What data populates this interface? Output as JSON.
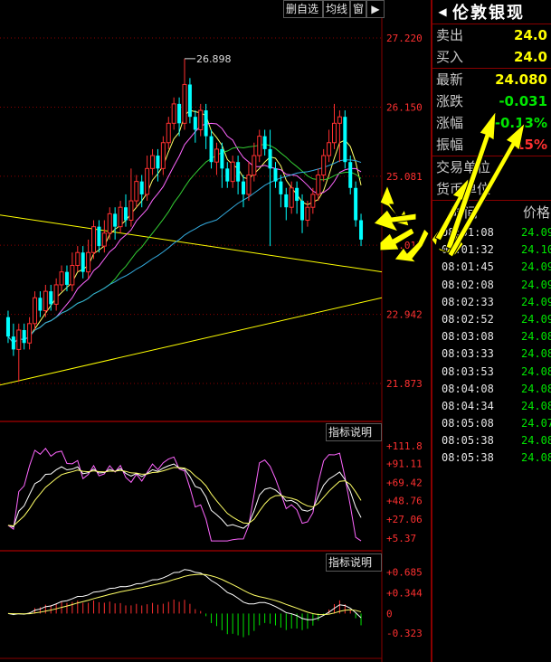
{
  "toolbar": {
    "btn1": "删自选",
    "btn2": "均线",
    "btn3": "窗"
  },
  "panel_labels": {
    "ind1": "指标说明",
    "ind2": "指标说明"
  },
  "quote": {
    "name": "伦敦银现",
    "ask_label": "卖出",
    "ask_value": "24.0",
    "bid_label": "买入",
    "bid_value": "24.0",
    "last_label": "最新",
    "last_value": "24.080",
    "chg_label": "涨跌",
    "chg_value": "-0.031",
    "pct_label": "涨幅",
    "pct_value": "-0.13%",
    "amp_label": "振幅",
    "amp_value": "15%",
    "unit1_label": "交易单位",
    "unit2_label": "货币单位",
    "col_time": "时间",
    "col_price": "价格"
  },
  "ticks": [
    {
      "time": "08:01:08",
      "price": "24.09"
    },
    {
      "time": "08:01:32",
      "price": "24.10"
    },
    {
      "time": "08:01:45",
      "price": "24.09"
    },
    {
      "time": "08:02:08",
      "price": "24.09"
    },
    {
      "time": "08:02:33",
      "price": "24.09"
    },
    {
      "time": "08:02:52",
      "price": "24.09"
    },
    {
      "time": "08:03:08",
      "price": "24.08"
    },
    {
      "time": "08:03:33",
      "price": "24.08"
    },
    {
      "time": "08:03:53",
      "price": "24.08"
    },
    {
      "time": "08:04:08",
      "price": "24.08"
    },
    {
      "time": "08:04:34",
      "price": "24.08"
    },
    {
      "time": "08:05:08",
      "price": "24.07"
    },
    {
      "time": "08:05:38",
      "price": "24.08"
    },
    {
      "time": "08:05:38",
      "price": "24.08"
    }
  ],
  "colors": {
    "up": "#ff3030",
    "down": "#00ffff",
    "grid": "#8a0000",
    "yellow": "#ffff00",
    "ma_yellow": "#ffff66",
    "ma_magenta": "#ff66ff",
    "ma_green": "#33cc33",
    "ma_cyan": "#33aadd"
  },
  "chart_data": {
    "type": "candlestick",
    "y_ticks": [
      "27.220",
      "26.150",
      "25.081",
      "24.013",
      "22.942",
      "21.873"
    ],
    "ylim": [
      21.3,
      27.5
    ],
    "high_annotation": "26.898",
    "candles": [
      [
        22.9,
        22.6,
        23.0,
        22.5
      ],
      [
        22.6,
        22.4,
        22.8,
        22.3
      ],
      [
        22.4,
        22.7,
        22.8,
        21.9
      ],
      [
        22.7,
        22.5,
        22.8,
        22.4
      ],
      [
        22.5,
        22.8,
        22.9,
        22.4
      ],
      [
        22.8,
        23.2,
        23.3,
        22.7
      ],
      [
        23.2,
        23.0,
        23.3,
        22.9
      ],
      [
        23.0,
        23.3,
        23.4,
        22.9
      ],
      [
        23.3,
        23.1,
        23.4,
        23.0
      ],
      [
        23.1,
        23.4,
        23.5,
        23.0
      ],
      [
        23.4,
        23.6,
        23.7,
        23.3
      ],
      [
        23.6,
        23.4,
        23.7,
        23.3
      ],
      [
        23.4,
        23.7,
        23.9,
        23.3
      ],
      [
        23.7,
        23.9,
        24.0,
        23.6
      ],
      [
        23.9,
        23.6,
        24.0,
        23.5
      ],
      [
        23.6,
        23.9,
        24.1,
        23.5
      ],
      [
        23.9,
        24.3,
        24.4,
        23.8
      ],
      [
        24.3,
        24.0,
        24.4,
        23.9
      ],
      [
        24.0,
        24.2,
        24.4,
        23.9
      ],
      [
        24.2,
        24.5,
        24.6,
        24.1
      ],
      [
        24.5,
        24.3,
        24.6,
        24.1
      ],
      [
        24.3,
        24.6,
        24.7,
        24.2
      ],
      [
        24.6,
        24.4,
        24.8,
        24.3
      ],
      [
        24.4,
        24.7,
        25.2,
        24.3
      ],
      [
        24.7,
        25.0,
        25.1,
        24.6
      ],
      [
        25.0,
        24.8,
        25.1,
        24.6
      ],
      [
        24.8,
        25.2,
        25.4,
        24.7
      ],
      [
        25.2,
        25.4,
        25.5,
        25.1
      ],
      [
        25.4,
        25.2,
        25.5,
        25.0
      ],
      [
        25.2,
        25.6,
        25.7,
        25.1
      ],
      [
        25.6,
        25.9,
        26.0,
        25.5
      ],
      [
        25.9,
        26.2,
        26.3,
        25.8
      ],
      [
        26.2,
        25.9,
        26.3,
        25.7
      ],
      [
        25.9,
        26.5,
        26.9,
        25.8
      ],
      [
        26.5,
        26.0,
        26.6,
        25.9
      ],
      [
        26.0,
        25.8,
        26.1,
        25.6
      ],
      [
        25.8,
        26.1,
        26.2,
        25.7
      ],
      [
        26.1,
        25.7,
        26.2,
        25.5
      ],
      [
        25.7,
        25.3,
        25.8,
        25.2
      ],
      [
        25.3,
        25.5,
        25.6,
        25.1
      ],
      [
        25.5,
        25.2,
        25.6,
        24.9
      ],
      [
        25.2,
        25.0,
        25.3,
        24.9
      ],
      [
        25.0,
        25.3,
        25.4,
        24.9
      ],
      [
        25.3,
        25.0,
        25.4,
        24.8
      ],
      [
        25.0,
        24.8,
        25.1,
        24.6
      ],
      [
        24.8,
        25.1,
        25.3,
        24.7
      ],
      [
        25.1,
        25.4,
        25.6,
        25.0
      ],
      [
        25.4,
        25.7,
        25.8,
        25.3
      ],
      [
        25.7,
        25.5,
        25.8,
        25.4
      ],
      [
        25.5,
        25.2,
        25.8,
        24.0
      ],
      [
        25.2,
        25.0,
        25.3,
        24.9
      ],
      [
        25.0,
        24.8,
        25.1,
        24.6
      ],
      [
        24.8,
        24.6,
        24.9,
        24.4
      ],
      [
        24.6,
        24.9,
        25.0,
        24.5
      ],
      [
        24.9,
        24.7,
        25.0,
        24.5
      ],
      [
        24.7,
        24.4,
        24.8,
        24.2
      ],
      [
        24.4,
        24.6,
        24.7,
        24.3
      ],
      [
        24.6,
        24.8,
        24.9,
        24.5
      ],
      [
        24.8,
        25.1,
        25.2,
        24.7
      ],
      [
        25.1,
        25.4,
        25.5,
        25.0
      ],
      [
        25.4,
        25.6,
        25.8,
        25.3
      ],
      [
        25.6,
        25.9,
        26.2,
        25.5
      ],
      [
        25.9,
        26.0,
        26.1,
        25.3
      ],
      [
        26.0,
        25.3,
        26.1,
        25.2
      ],
      [
        25.3,
        24.9,
        25.4,
        24.8
      ],
      [
        24.9,
        24.4,
        25.0,
        24.3
      ],
      [
        24.4,
        24.1,
        24.5,
        24.0
      ]
    ],
    "macd_ticks": [
      "+0.685",
      "+0.344",
      "0",
      "-0.323"
    ],
    "macd_ylim": [
      -0.5,
      0.75
    ],
    "ind1_ticks": [
      "+111.8",
      "+91.11",
      "+69.42",
      "+48.76",
      "+27.06",
      "+5.37"
    ],
    "ind1_ylim": [
      0,
      120
    ]
  }
}
